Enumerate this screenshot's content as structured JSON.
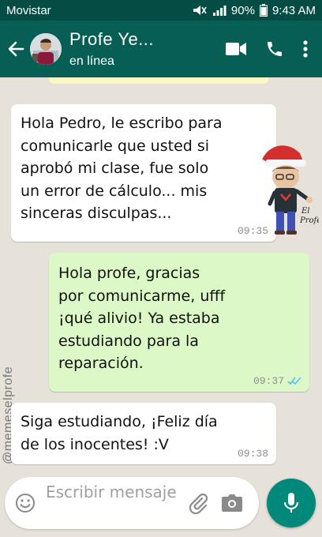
{
  "status_bar": {
    "carrier": "Movistar",
    "battery": "90%",
    "time": "9:43 AM"
  },
  "header": {
    "contact_name": "Profe Ye...",
    "contact_status": "en línea",
    "icons": [
      "back-arrow-icon",
      "video-call-icon",
      "phone-icon",
      "more-vert-icon"
    ]
  },
  "watermark": "@memeselprofe",
  "sticker": {
    "caption_line1": "El",
    "caption_line2": "Profe"
  },
  "messages": [
    {
      "direction": "incoming",
      "text": "Hola Pedro, le escribo para\ncomunicarle que usted si\naprobó mi clase,  fue solo\nun error de cálculo...  mis\nsinceras disculpas...",
      "time": "09:35"
    },
    {
      "direction": "outgoing",
      "text": "Hola profe,  gracias\npor comunicarme, ufff\n¡qué alivio! Ya estaba\nestudiando para la\nreparación.",
      "time": "09:37",
      "status": "read"
    },
    {
      "direction": "incoming",
      "text": "Siga estudiando,  ¡Feliz día\nde los inocentes! :V",
      "time": "09:38"
    }
  ],
  "composer": {
    "placeholder": "Escribir mensaje"
  },
  "colors": {
    "header": "#075e54",
    "status_bar": "#054d44",
    "outgoing_bubble": "#dcf8c6",
    "incoming_bubble": "#ffffff",
    "mic_button": "#00897b",
    "read_ticks": "#4fc3f7"
  }
}
